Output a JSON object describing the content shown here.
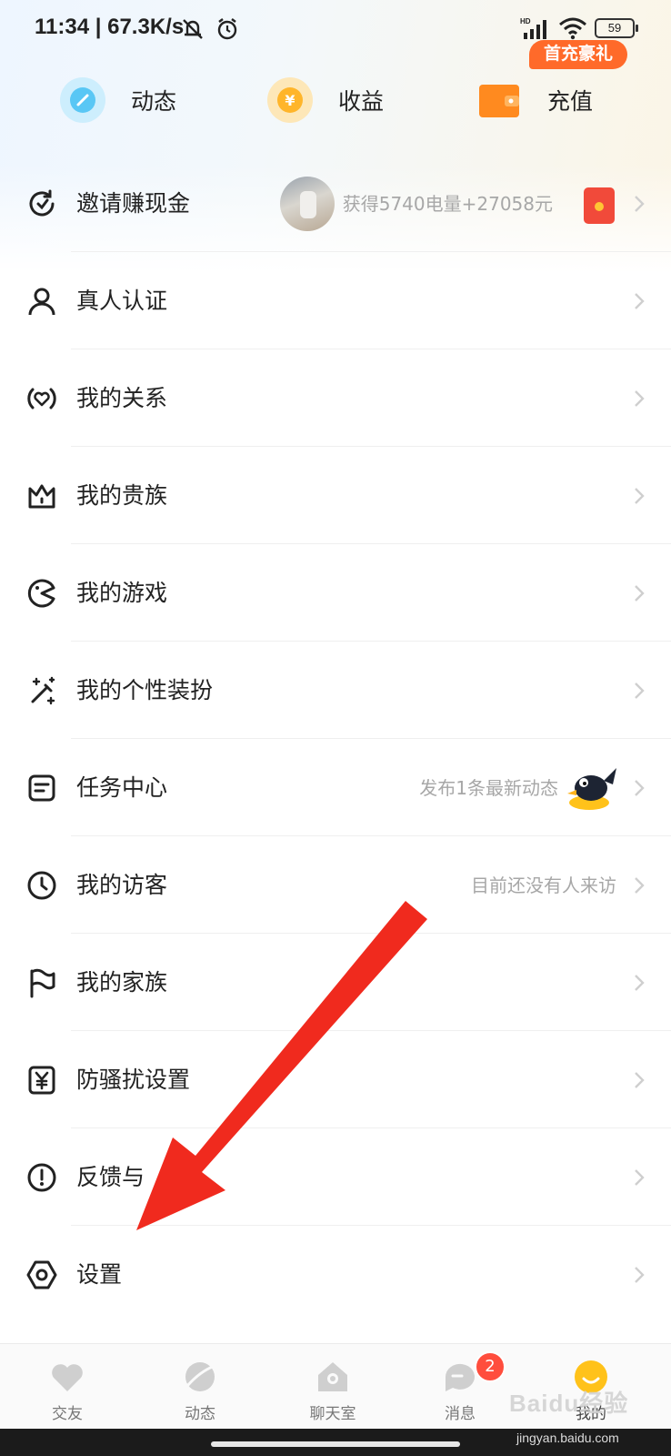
{
  "status_bar": {
    "time": "11:34 | 67.3K/s",
    "battery": "59",
    "hd": "HD"
  },
  "quick_actions": [
    {
      "label": "动态",
      "icon": "pen-icon"
    },
    {
      "label": "收益",
      "icon": "yuan-coin-icon"
    },
    {
      "label": "充值",
      "icon": "wallet-icon"
    }
  ],
  "promo_badge": "首充豪礼",
  "menu": [
    {
      "label": "邀请赚现金",
      "sub": "获得5740电量+27058元",
      "icon": "invite-refresh-icon"
    },
    {
      "label": "真人认证",
      "sub": "",
      "icon": "person-icon"
    },
    {
      "label": "我的关系",
      "sub": "",
      "icon": "heart-circle-icon"
    },
    {
      "label": "我的贵族",
      "sub": "",
      "icon": "crown-icon"
    },
    {
      "label": "我的游戏",
      "sub": "",
      "icon": "game-palette-icon"
    },
    {
      "label": "我的个性装扮",
      "sub": "",
      "icon": "magic-wand-icon"
    },
    {
      "label": "任务中心",
      "sub": "发布1条最新动态",
      "icon": "task-note-icon"
    },
    {
      "label": "我的访客",
      "sub": "目前还没有人来访",
      "icon": "clock-icon"
    },
    {
      "label": "我的家族",
      "sub": "",
      "icon": "flag-icon"
    },
    {
      "label": "防骚扰设置",
      "sub": "",
      "icon": "shield-yen-icon"
    },
    {
      "label": "反馈与",
      "sub": "",
      "icon": "exclamation-circle-icon"
    },
    {
      "label": "设置",
      "sub": "",
      "icon": "settings-icon"
    }
  ],
  "bottom_nav": [
    {
      "label": "交友",
      "icon": "heart-icon"
    },
    {
      "label": "动态",
      "icon": "planet-icon"
    },
    {
      "label": "聊天室",
      "icon": "house-chat-icon"
    },
    {
      "label": "消息",
      "icon": "chat-bubble-icon",
      "badge": "2"
    },
    {
      "label": "我的",
      "icon": "smile-face-icon"
    }
  ],
  "watermark": "Baidu经验",
  "watermark_url": "jingyan.baidu.com",
  "colors": {
    "accent_orange": "#ff8a1f",
    "annotation_red": "#f02a1e",
    "badge_red": "#ff4d3d"
  }
}
